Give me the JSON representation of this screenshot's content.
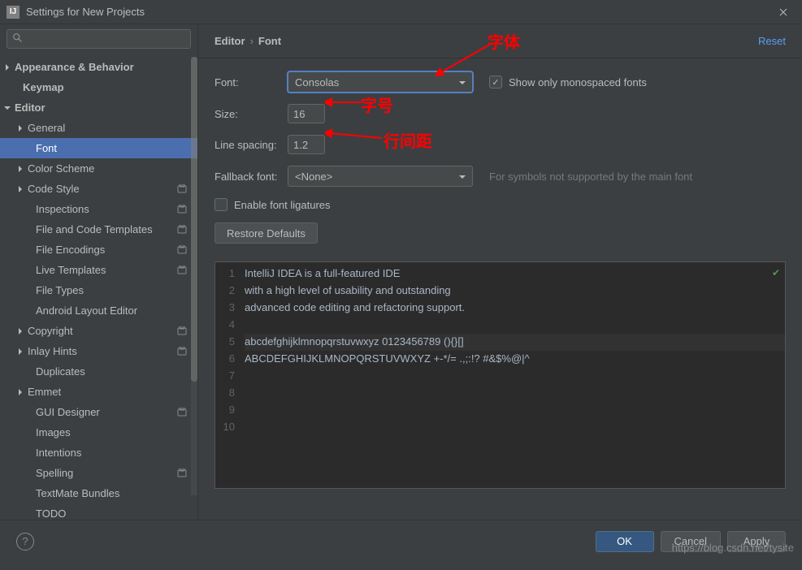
{
  "window": {
    "title": "Settings for New Projects",
    "icon_text": "IJ"
  },
  "search": {
    "placeholder": ""
  },
  "sidebar": {
    "items": [
      {
        "label": "Appearance & Behavior",
        "arrow": "right",
        "bold": true,
        "depth": 0
      },
      {
        "label": "Keymap",
        "bold": true,
        "depth": 0,
        "indent": 1
      },
      {
        "label": "Editor",
        "arrow": "down",
        "bold": true,
        "depth": 0
      },
      {
        "label": "General",
        "arrow": "right",
        "depth": 1
      },
      {
        "label": "Font",
        "depth": 2,
        "selected": true
      },
      {
        "label": "Color Scheme",
        "arrow": "right",
        "depth": 1
      },
      {
        "label": "Code Style",
        "arrow": "right",
        "depth": 1,
        "badge": true
      },
      {
        "label": "Inspections",
        "depth": 2,
        "badge": true
      },
      {
        "label": "File and Code Templates",
        "depth": 2,
        "badge": true
      },
      {
        "label": "File Encodings",
        "depth": 2,
        "badge": true
      },
      {
        "label": "Live Templates",
        "depth": 2,
        "badge": true
      },
      {
        "label": "File Types",
        "depth": 2
      },
      {
        "label": "Android Layout Editor",
        "depth": 2
      },
      {
        "label": "Copyright",
        "arrow": "right",
        "depth": 1,
        "badge": true
      },
      {
        "label": "Inlay Hints",
        "arrow": "right",
        "depth": 1,
        "badge": true
      },
      {
        "label": "Duplicates",
        "depth": 2
      },
      {
        "label": "Emmet",
        "arrow": "right",
        "depth": 1
      },
      {
        "label": "GUI Designer",
        "depth": 2,
        "badge": true
      },
      {
        "label": "Images",
        "depth": 2
      },
      {
        "label": "Intentions",
        "depth": 2
      },
      {
        "label": "Spelling",
        "depth": 2,
        "badge": true
      },
      {
        "label": "TextMate Bundles",
        "depth": 2
      },
      {
        "label": "TODO",
        "depth": 2
      }
    ]
  },
  "breadcrumb": {
    "parent": "Editor",
    "current": "Font"
  },
  "reset_label": "Reset",
  "form": {
    "font_label": "Font:",
    "font_value": "Consolas",
    "mono_label": "Show only monospaced fonts",
    "mono_checked": true,
    "size_label": "Size:",
    "size_value": "16",
    "spacing_label": "Line spacing:",
    "spacing_value": "1.2",
    "fallback_label": "Fallback font:",
    "fallback_value": "<None>",
    "fallback_hint": "For symbols not supported by the main font",
    "ligatures_label": "Enable font ligatures",
    "restore_label": "Restore Defaults"
  },
  "preview": {
    "lines": [
      "IntelliJ IDEA is a full-featured IDE",
      "with a high level of usability and outstanding",
      "advanced code editing and refactoring support.",
      "",
      "abcdefghijklmnopqrstuvwxyz 0123456789 (){}[]",
      "ABCDEFGHIJKLMNOPQRSTUVWXYZ +-*/= .,;:!? #&$%@|^",
      "",
      "",
      "",
      ""
    ]
  },
  "footer": {
    "ok": "OK",
    "cancel": "Cancel",
    "apply": "Apply",
    "help": "?"
  },
  "annotations": {
    "font": "字体",
    "size": "字号",
    "spacing": "行间距"
  },
  "watermark": "https://blog.csdn.net/tysite"
}
